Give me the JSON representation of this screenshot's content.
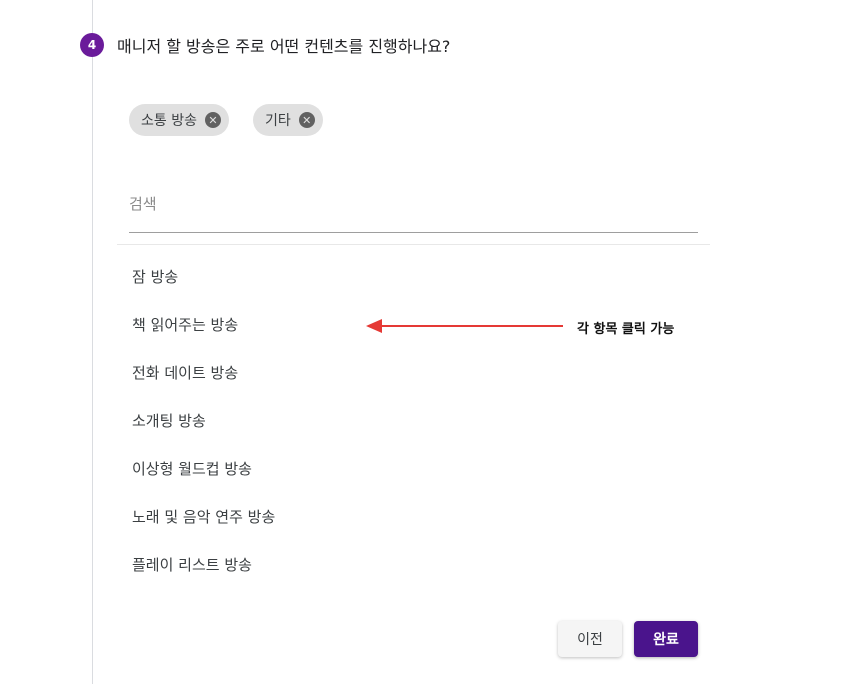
{
  "step": {
    "number": "4",
    "question": "매니저 할 방송은 주로 어떤 컨텐츠를 진행하나요?"
  },
  "selected_chips": [
    {
      "label": "소통 방송",
      "remove_icon": "close-circle-icon"
    },
    {
      "label": "기타",
      "remove_icon": "close-circle-icon"
    }
  ],
  "search": {
    "placeholder": "검색",
    "value": ""
  },
  "options": [
    {
      "label": "잠 방송"
    },
    {
      "label": "책 읽어주는 방송"
    },
    {
      "label": "전화 데이트 방송"
    },
    {
      "label": "소개팅 방송"
    },
    {
      "label": "이상형 월드컵 방송"
    },
    {
      "label": "노래 및 음악 연주 방송"
    },
    {
      "label": "플레이 리스트 방송"
    }
  ],
  "annotation": {
    "text": "각 항목 클릭 가능",
    "arrow_color": "#e53935"
  },
  "buttons": {
    "prev_label": "이전",
    "done_label": "완료"
  },
  "colors": {
    "accent": "#6a1b9a",
    "primary_button": "#4a148c",
    "chip_bg": "#e0e0e0"
  }
}
